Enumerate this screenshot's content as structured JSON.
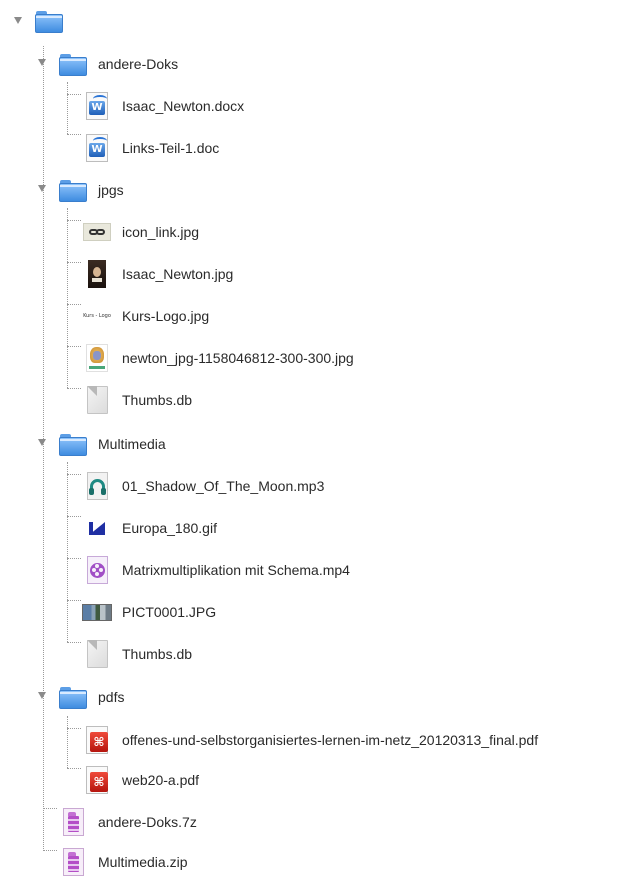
{
  "tree": {
    "root": {
      "label": ""
    },
    "andere_doks": {
      "label": "andere-Doks",
      "files": [
        "Isaac_Newton.docx",
        "Links-Teil-1.doc"
      ]
    },
    "jpgs": {
      "label": "jpgs",
      "files": [
        "icon_link.jpg",
        "Isaac_Newton.jpg",
        "Kurs-Logo.jpg",
        "newton_jpg-1158046812-300-300.jpg",
        "Thumbs.db"
      ]
    },
    "multimedia": {
      "label": "Multimedia",
      "files": [
        "01_Shadow_Of_The_Moon.mp3",
        "Europa_180.gif",
        "Matrixmultiplikation mit Schema.mp4",
        "PICT0001.JPG",
        "Thumbs.db"
      ]
    },
    "pdfs": {
      "label": "pdfs",
      "files": [
        "offenes-und-selbstorganisiertes-lernen-im-netz_20120313_final.pdf",
        "web20-a.pdf"
      ]
    },
    "archives": [
      "andere-Doks.7z",
      "Multimedia.zip"
    ]
  },
  "thumbnails": {
    "kurs_logo_text": "Kurs - Logo"
  },
  "colors": {
    "folder_blue": "#5c9ee6",
    "pdf_red": "#d0261a",
    "archive_purple": "#b44dc7",
    "text": "#2a2a2a"
  }
}
